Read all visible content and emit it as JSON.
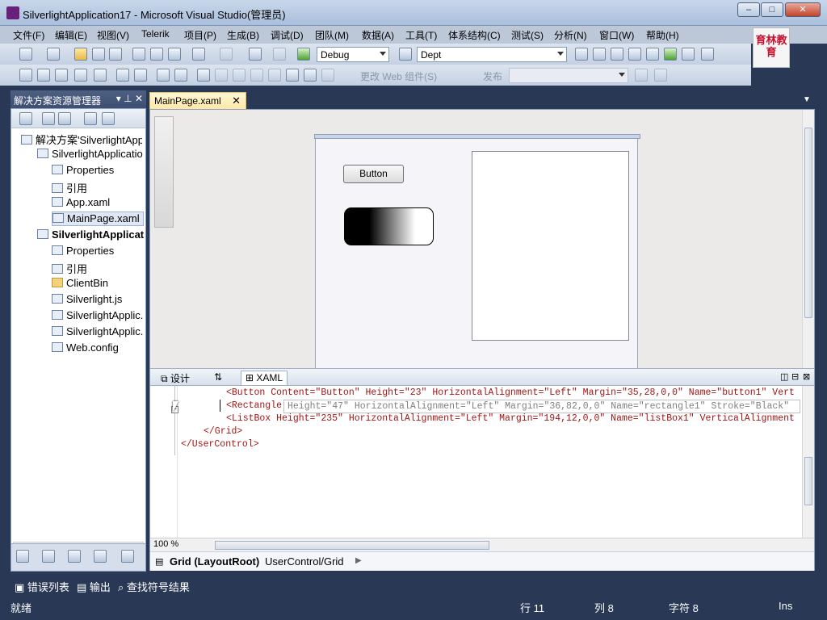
{
  "window": {
    "title": "SilverlightApplication17 - Microsoft Visual Studio(管理员)"
  },
  "menubar": {
    "items": [
      "文件(F)",
      "编辑(E)",
      "视图(V)",
      "Telerik",
      "项目(P)",
      "生成(B)",
      "调试(D)",
      "团队(M)",
      "数据(A)",
      "工具(T)",
      "体系结构(C)",
      "测试(S)",
      "分析(N)",
      "窗口(W)",
      "帮助(H)"
    ]
  },
  "toolbar1": {
    "config_combo": "Debug",
    "find_combo": "Dept"
  },
  "toolbar2": {
    "text_change": "更改 Web 组件(S)",
    "text_publish": "发布"
  },
  "logo": {
    "text": "育林教育"
  },
  "solution_explorer": {
    "title": "解决方案资源管理器",
    "items": [
      {
        "label": "解决方案'SilverlightApp",
        "level": 0
      },
      {
        "label": "SilverlightApplicatio",
        "level": 1
      },
      {
        "label": "Properties",
        "level": 2
      },
      {
        "label": "引用",
        "level": 2
      },
      {
        "label": "App.xaml",
        "level": 2
      },
      {
        "label": "MainPage.xaml",
        "level": 2,
        "selected": true
      },
      {
        "label": "SilverlightApplicat",
        "level": 1,
        "bold": true
      },
      {
        "label": "Properties",
        "level": 2
      },
      {
        "label": "引用",
        "level": 2
      },
      {
        "label": "ClientBin",
        "level": 2
      },
      {
        "label": "Silverlight.js",
        "level": 2
      },
      {
        "label": "SilverlightApplic.",
        "level": 2
      },
      {
        "label": "SilverlightApplic.",
        "level": 2
      },
      {
        "label": "Web.config",
        "level": 2
      }
    ]
  },
  "document": {
    "tab_label": "MainPage.xaml",
    "designer": {
      "button_content": "Button"
    },
    "split_tabs": [
      "设计",
      "⇅",
      "XAML"
    ],
    "xaml_lines": {
      "line1": "<Button Content=\"Button\" Height=\"23\" HorizontalAlignment=\"Left\" Margin=\"35,28,0,0\" Name=\"button1\" Vert",
      "line2": "<Rectangle",
      "line2_hint": "Height=\"47\" HorizontalAlignment=\"Left\" Margin=\"36,82,0,0\" Name=\"rectangle1\" Stroke=\"Black\"",
      "line3": "<ListBox Height=\"235\" HorizontalAlignment=\"Left\" Margin=\"194,12,0,0\" Name=\"listBox1\" VerticalAlignment",
      "line4": "</Grid>",
      "line5": "</UserControl>"
    },
    "zoom": "100 %",
    "breadcrumb_main": "Grid (LayoutRoot)",
    "breadcrumb_path": "UserControl/Grid"
  },
  "bottom_tabs": [
    "错误列表",
    "输出",
    "查找符号结果"
  ],
  "statusbar": {
    "left": "就绪",
    "line": "行 11",
    "col": "列 8",
    "ch": "字符 8",
    "mode": "Ins"
  },
  "colors": {
    "frame": "#293955",
    "active_tab": "#ffe8a6",
    "xaml_keyword": "#a31515",
    "xaml_attr": "#ff0000",
    "xaml_value": "#0000ff"
  }
}
